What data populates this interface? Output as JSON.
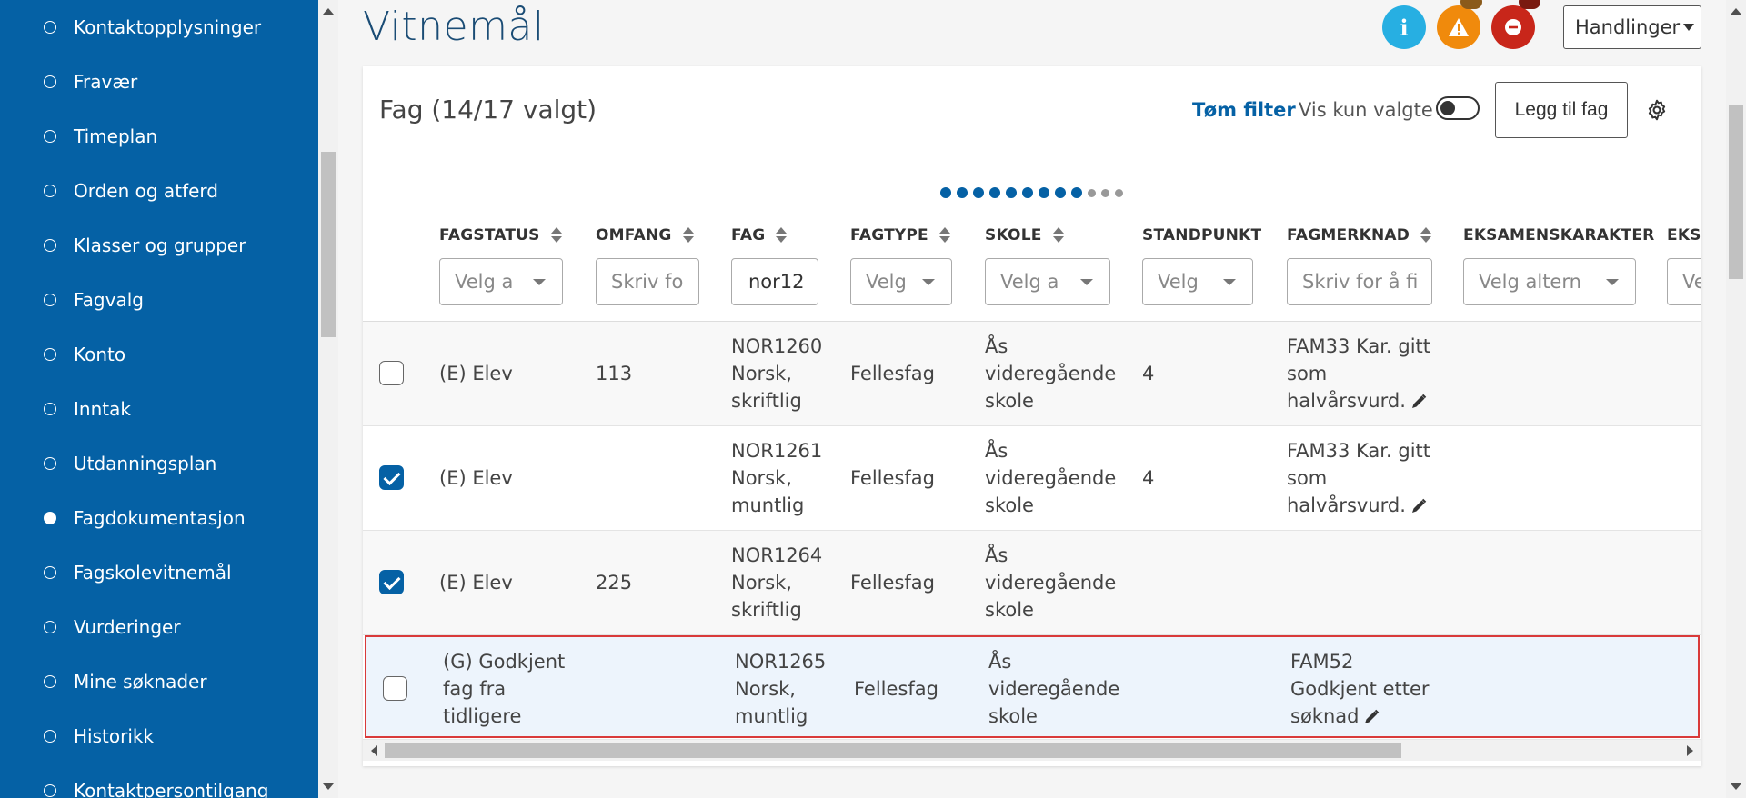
{
  "sidebar": {
    "items": [
      {
        "label": "Kontaktopplysninger",
        "active": false
      },
      {
        "label": "Fravær",
        "active": false
      },
      {
        "label": "Timeplan",
        "active": false
      },
      {
        "label": "Orden og atferd",
        "active": false
      },
      {
        "label": "Klasser og grupper",
        "active": false
      },
      {
        "label": "Fagvalg",
        "active": false
      },
      {
        "label": "Konto",
        "active": false
      },
      {
        "label": "Inntak",
        "active": false
      },
      {
        "label": "Utdanningsplan",
        "active": false
      },
      {
        "label": "Fagdokumentasjon",
        "active": true
      },
      {
        "label": "Fagskolevitnemål",
        "active": false
      },
      {
        "label": "Vurderinger",
        "active": false
      },
      {
        "label": "Mine søknader",
        "active": false
      },
      {
        "label": "Historikk",
        "active": false
      },
      {
        "label": "Kontaktpersontilgang",
        "active": false
      }
    ]
  },
  "header": {
    "title": "Vitnemål",
    "info_label": "i",
    "actions_label": "Handlinger"
  },
  "panel": {
    "title": "Fag (14/17 valgt)",
    "clear_filter": "Tøm filter",
    "only_selected_label": "Vis kun valgte",
    "only_selected_on": false,
    "add_subject": "Legg til fag",
    "pager": {
      "total": 12,
      "active": 9
    }
  },
  "table": {
    "columns": [
      {
        "key": "fagstatus",
        "label": "FAGSTATUS",
        "filter_placeholder": "Velg a",
        "filter_type": "select"
      },
      {
        "key": "omfang",
        "label": "OMFANG",
        "filter_placeholder": "Skriv fo",
        "filter_type": "text"
      },
      {
        "key": "fag",
        "label": "FAG",
        "filter_value": "nor12",
        "filter_type": "text"
      },
      {
        "key": "fagtype",
        "label": "FAGTYPE",
        "filter_placeholder": "Velg",
        "filter_type": "select"
      },
      {
        "key": "skole",
        "label": "SKOLE",
        "filter_placeholder": "Velg a",
        "filter_type": "select"
      },
      {
        "key": "standpunkt",
        "label": "STANDPUNKT",
        "filter_placeholder": "Velg",
        "filter_type": "select"
      },
      {
        "key": "fagmerknad",
        "label": "FAGMERKNAD",
        "filter_placeholder": "Skriv for å fi",
        "filter_type": "text"
      },
      {
        "key": "eksamenskarakter",
        "label": "EKSAMENSKARAKTER",
        "filter_placeholder": "Velg altern",
        "filter_type": "select"
      },
      {
        "key": "eksamen2",
        "label": "EKSA",
        "filter_placeholder": "Ve",
        "filter_type": "select"
      }
    ],
    "rows": [
      {
        "checked": false,
        "fagstatus": [
          "(E) Elev"
        ],
        "omfang": "113",
        "fag": [
          "NOR1260",
          "Norsk,",
          "skriftlig"
        ],
        "fagtype": "Fellesfag",
        "skole": [
          "Ås",
          "videregående",
          "skole"
        ],
        "standpunkt": "4",
        "fagmerknad": [
          "FAM33 Kar. gitt",
          "som",
          "halvårsvurd."
        ],
        "editable": true
      },
      {
        "checked": true,
        "fagstatus": [
          "(E) Elev"
        ],
        "omfang": "",
        "fag": [
          "NOR1261",
          "Norsk,",
          "muntlig"
        ],
        "fagtype": "Fellesfag",
        "skole": [
          "Ås",
          "videregående",
          "skole"
        ],
        "standpunkt": "4",
        "fagmerknad": [
          "FAM33 Kar. gitt",
          "som",
          "halvårsvurd."
        ],
        "editable": true
      },
      {
        "checked": true,
        "fagstatus": [
          "(E) Elev"
        ],
        "omfang": "225",
        "fag": [
          "NOR1264",
          "Norsk,",
          "skriftlig"
        ],
        "fagtype": "Fellesfag",
        "skole": [
          "Ås",
          "videregående",
          "skole"
        ],
        "standpunkt": "",
        "fagmerknad": [],
        "editable": false
      },
      {
        "checked": false,
        "fagstatus": [
          "(G) Godkjent",
          "fag fra",
          "tidligere"
        ],
        "omfang": "",
        "fag": [
          "NOR1265",
          "Norsk,",
          "muntlig"
        ],
        "fagtype": "Fellesfag",
        "skole": [
          "Ås",
          "videregående",
          "skole"
        ],
        "standpunkt": "",
        "fagmerknad": [
          "FAM52",
          "Godkjent etter",
          "søknad"
        ],
        "editable": true
      }
    ]
  },
  "colors": {
    "sidebar_bg": "#0561a5",
    "title": "#1a4c75",
    "link": "#0561a5",
    "info": "#27afe2",
    "warning": "#f08a0c",
    "error": "#c8261a",
    "highlight_border": "#d93a3a"
  }
}
